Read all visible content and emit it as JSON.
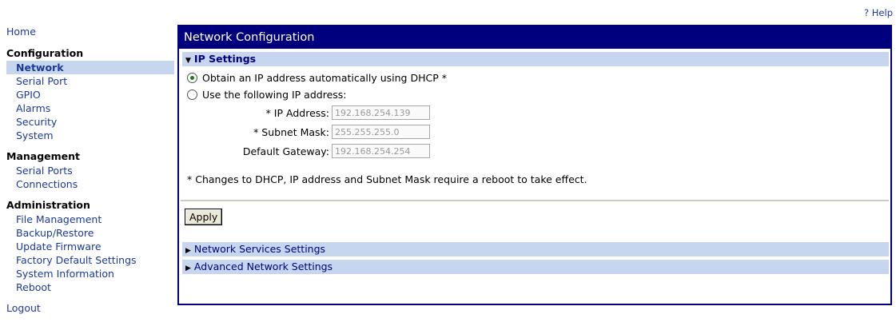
{
  "help": "? Help",
  "sidebar": {
    "home": "Home",
    "groups": [
      {
        "heading": "Configuration",
        "items": [
          "Network",
          "Serial Port",
          "GPIO",
          "Alarms",
          "Security",
          "System"
        ]
      },
      {
        "heading": "Management",
        "items": [
          "Serial Ports",
          "Connections"
        ]
      },
      {
        "heading": "Administration",
        "items": [
          "File Management",
          "Backup/Restore",
          "Update Firmware",
          "Factory Default Settings",
          "System Information",
          "Reboot"
        ]
      }
    ],
    "active": "Network",
    "logout": "Logout"
  },
  "panel": {
    "title": "Network Configuration",
    "ip_settings": {
      "heading": "IP Settings",
      "dhcp_option": "Obtain an IP address automatically using DHCP *",
      "static_option": "Use the following IP address:",
      "selected": "dhcp",
      "fields": {
        "ip_label": "* IP Address:",
        "ip_value": "192.168.254.139",
        "mask_label": "* Subnet Mask:",
        "mask_value": "255.255.255.0",
        "gateway_label": "Default Gateway:",
        "gateway_value": "192.168.254.254"
      },
      "note": "* Changes to DHCP, IP address and Subnet Mask require a reboot to take effect.",
      "apply": "Apply"
    },
    "network_services": "Network Services Settings",
    "advanced": "Advanced Network Settings"
  },
  "colors": {
    "accent": "#00007f",
    "section_bar": "#c7d6ef",
    "link": "#1a3a9c"
  }
}
